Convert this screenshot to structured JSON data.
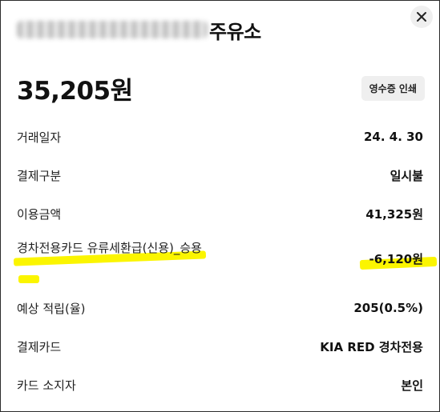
{
  "header": {
    "merchant_suffix": "주유소",
    "close_icon": "close-icon"
  },
  "summary": {
    "amount": "35,205원",
    "receipt_button": "영수증 인쇄"
  },
  "details": [
    {
      "label": "거래일자",
      "value": "24. 4. 30"
    },
    {
      "label": "결제구분",
      "value": "일시불"
    },
    {
      "label": "이용금액",
      "value": "41,325원"
    },
    {
      "label": "경차전용카드 유류세환급(신용)_승용",
      "value": "-6,120원"
    },
    {
      "label": "예상 적립(율)",
      "value": "205(0.5%)"
    },
    {
      "label": "결제카드",
      "value": "KIA RED 경차전용"
    },
    {
      "label": "카드 소지자",
      "value": "본인"
    }
  ],
  "colors": {
    "highlight": "#fbf500",
    "button_bg": "#efefef",
    "text": "#111111"
  }
}
